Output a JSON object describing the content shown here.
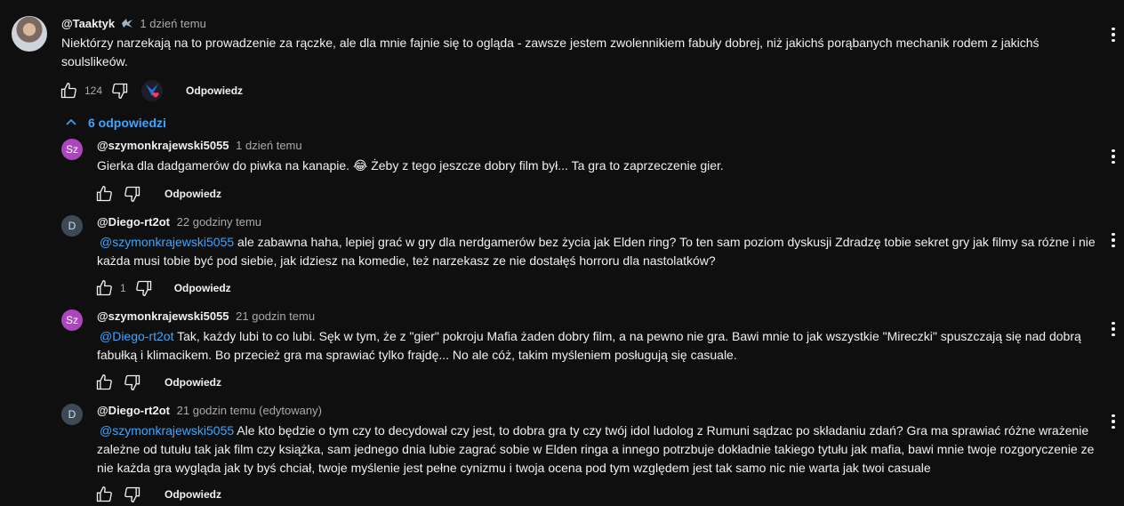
{
  "top_comment": {
    "author": "@Taaktyk",
    "time": "1 dzień temu",
    "text_line1": "Niektórzy narzekają na to prowadzenie za rączke, ale dla mnie fajnie się to ogląda - zawsze jestem zwolennikiem fabuły dobrej, niż jakichś porąbanych mechanik rodem z jakichś",
    "text_line2": "soulslikeów.",
    "likes": "124",
    "reply_label": "Odpowiedz"
  },
  "replies_toggle": "6 odpowiedzi",
  "replies": [
    {
      "avatar": "Sz",
      "author": "@szymonkrajewski5055",
      "time": "1 dzień temu",
      "text": "Gierka dla dadgamerów do piwka na kanapie. 😂  Żeby z tego jeszcze dobry film był... Ta gra to zaprzeczenie gier.",
      "reply_label": "Odpowiedz"
    },
    {
      "avatar": "D",
      "author": "@Diego-rt2ot",
      "time": "22 godziny temu",
      "mention": "@szymonkrajewski5055",
      "text_line1": "ale zabawna haha, lepiej grać w gry dla nerdgamerów bez życia jak Elden ring? To ten sam poziom dyskusji Zdradzę tobie sekret gry jak filmy sa różne i nie",
      "text_line2": "każda musi tobie być pod siebie, jak idziesz na komedie, też narzekasz ze nie dostałęś horroru dla nastolatków?",
      "likes": "1",
      "reply_label": "Odpowiedz"
    },
    {
      "avatar": "Sz",
      "author": "@szymonkrajewski5055",
      "time": "21 godzin temu",
      "mention": "@Diego-rt2ot",
      "text_line1": "Tak, każdy lubi to co lubi. Sęk w tym, że z \"gier\" pokroju Mafia żaden dobry film, a na pewno nie gra. Bawi mnie to jak wszystkie \"Mireczki\" spuszczają się nad dobrą",
      "text_line2": "fabułką i klimacikem. Bo przecież gra ma sprawiać tylko frajdę... No ale cóż, takim myśleniem posługują się casuale.",
      "reply_label": "Odpowiedz"
    },
    {
      "avatar": "D",
      "author": "@Diego-rt2ot",
      "time": "21 godzin temu (edytowany)",
      "mention": "@szymonkrajewski5055",
      "text_line1": "Ale kto będzie o tym czy to decydował czy jest, to dobra gra  ty czy twój idol ludolog z Rumuni sądzac po składaniu zdań? Gra ma sprawiać różne wrażenie",
      "text_line2": "zależne od tutułu tak jak film czy książka, sam jednego dnia lubie zagrać sobie w Elden ringa a innego potrzbuje dokładnie takiego tytułu jak mafia, bawi mnie twoje rozgoryczenie ze",
      "text_line3": "nie każda gra wygląda jak ty byś chciał, twoje myślenie jest pełne cynizmu i twoja ocena pod tym względem jest tak samo nic nie warta jak twoi casuale",
      "reply_label": "Odpowiedz"
    }
  ],
  "colors": {
    "background": "#0f0f0f",
    "text": "#f1f1f1",
    "muted": "#aaaaaa",
    "link": "#3ea6ff",
    "sz_avatar": "#ab47bc",
    "d_avatar": "#3c4a57"
  }
}
